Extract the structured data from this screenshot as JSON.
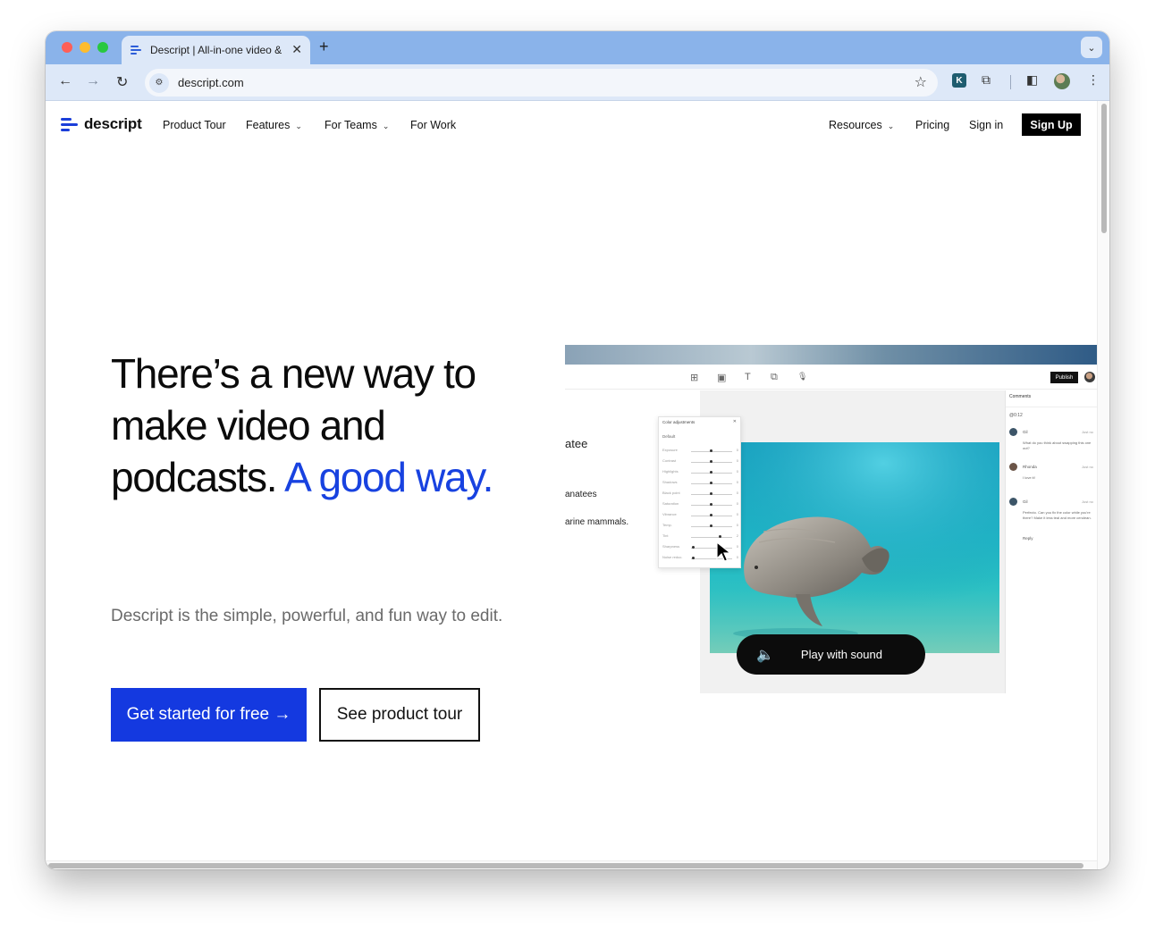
{
  "browser": {
    "tab_title": "Descript | All-in-one video & p",
    "tab_close": "✕",
    "new_tab": "+",
    "tab_menu": "⌄",
    "url": "descript.com",
    "back": "←",
    "forward": "→",
    "reload": "↻",
    "star": "☆",
    "ext_k": "K",
    "ext_puzzle": "⧉",
    "sidebar_toggle": "◧",
    "menu": "⋮"
  },
  "site_nav": {
    "logo_text": "descript",
    "product_tour": "Product Tour",
    "features": "Features",
    "for_teams": "For Teams",
    "for_work": "For Work",
    "resources": "Resources",
    "pricing": "Pricing",
    "sign_in": "Sign in",
    "sign_up": "Sign Up",
    "caret": "⌄"
  },
  "hero": {
    "title_main": "There’s a new way to make video and podcasts.",
    "title_accent": "A good way.",
    "subtitle": "Descript is the simple, powerful, and fun way to edit.",
    "cta_primary": "Get started for free →",
    "cta_secondary": "See product tour"
  },
  "mockup": {
    "publish": "Publish",
    "toolbar_icons": [
      "⊞",
      "▣",
      "T",
      "⧉",
      "🎙"
    ],
    "script_lines": [
      "atee",
      "anatees",
      "arine mammals."
    ],
    "color_panel": {
      "title": "Color adjustments",
      "close": "✕",
      "preset": "Default",
      "rows": [
        "Exposure",
        "Contrast",
        "Highlights",
        "Shadows",
        "Black point",
        "Saturation",
        "Vibrance",
        "Temp.",
        "Tint",
        "Sharpness",
        "Noise reduc."
      ],
      "values": [
        "0",
        "0",
        "0",
        "0",
        "0",
        "0",
        "0",
        "0",
        "2",
        "0",
        "0"
      ]
    },
    "play_label": "Play with sound",
    "play_icon": "🔈",
    "comments": {
      "header": "Comments",
      "timestamp": "@0:12",
      "items": [
        {
          "name": "Gil",
          "when": "Just no",
          "text": "What do you think about swapping this one out?"
        },
        {
          "name": "Rhonda",
          "when": "Just no",
          "text": "I love it!"
        },
        {
          "name": "Gil",
          "when": "Just no",
          "text": "Perfecto. Can you fix the color while you're there? Make it less teal and more cerulean."
        }
      ],
      "reply": "Reply"
    }
  },
  "colors": {
    "accent": "#1842e0",
    "cta": "#1439e0",
    "tabstrip": "#8ab3ea"
  }
}
